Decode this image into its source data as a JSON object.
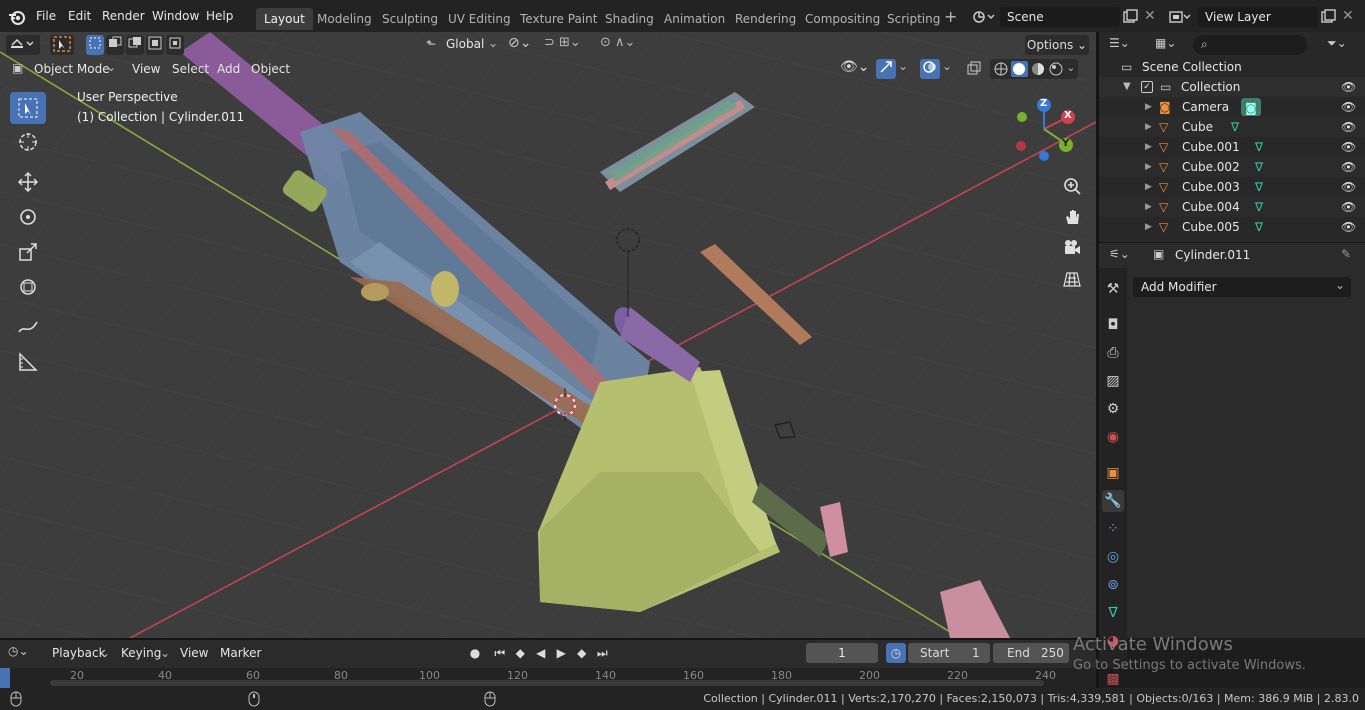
{
  "topbar": {
    "menus": [
      "File",
      "Edit",
      "Render",
      "Window",
      "Help"
    ],
    "workspaces": [
      "Layout",
      "Modeling",
      "Sculpting",
      "UV Editing",
      "Texture Paint",
      "Shading",
      "Animation",
      "Rendering",
      "Compositing",
      "Scripting"
    ],
    "active_workspace": "Layout",
    "scene": "Scene",
    "view_layer": "View Layer"
  },
  "viewport": {
    "orientation": "Global",
    "options_label": "Options",
    "mode": "Object Mode",
    "menus": [
      "View",
      "Select",
      "Add",
      "Object"
    ],
    "info_line1": "User Perspective",
    "info_line2": "(1) Collection | Cylinder.011",
    "axis_labels": {
      "x": "X",
      "y": "Y",
      "z": "Z"
    }
  },
  "outliner": {
    "scene_collection": "Scene Collection",
    "collection": "Collection",
    "items": [
      "Camera",
      "Cube",
      "Cube.001",
      "Cube.002",
      "Cube.003",
      "Cube.004",
      "Cube.005"
    ]
  },
  "properties": {
    "object_name": "Cylinder.011",
    "add_modifier": "Add Modifier"
  },
  "timeline": {
    "menus": [
      "Playback",
      "Keying",
      "View",
      "Marker"
    ],
    "current_frame": "1",
    "start_label": "Start",
    "start": "1",
    "end_label": "End",
    "end": "250",
    "ruler": [
      "20",
      "40",
      "60",
      "80",
      "100",
      "120",
      "140",
      "160",
      "180",
      "200",
      "220",
      "240"
    ]
  },
  "watermark": {
    "line1": "Activate Windows",
    "line2": "Go to Settings to activate Windows."
  },
  "statusbar": {
    "text": "Collection | Cylinder.011 | Verts:2,170,270 | Faces:2,150,073 | Tris:4,339,581 | Objects:0/163 | Mem: 386.9 MiB | 2.83.0"
  },
  "colors": {
    "accent": "#4772b3",
    "x_axis": "#d04050",
    "y_axis": "#7ab030",
    "z_axis": "#3a78d8",
    "mesh_icon": "#35c4a0",
    "object_icon": "#e8903a"
  }
}
